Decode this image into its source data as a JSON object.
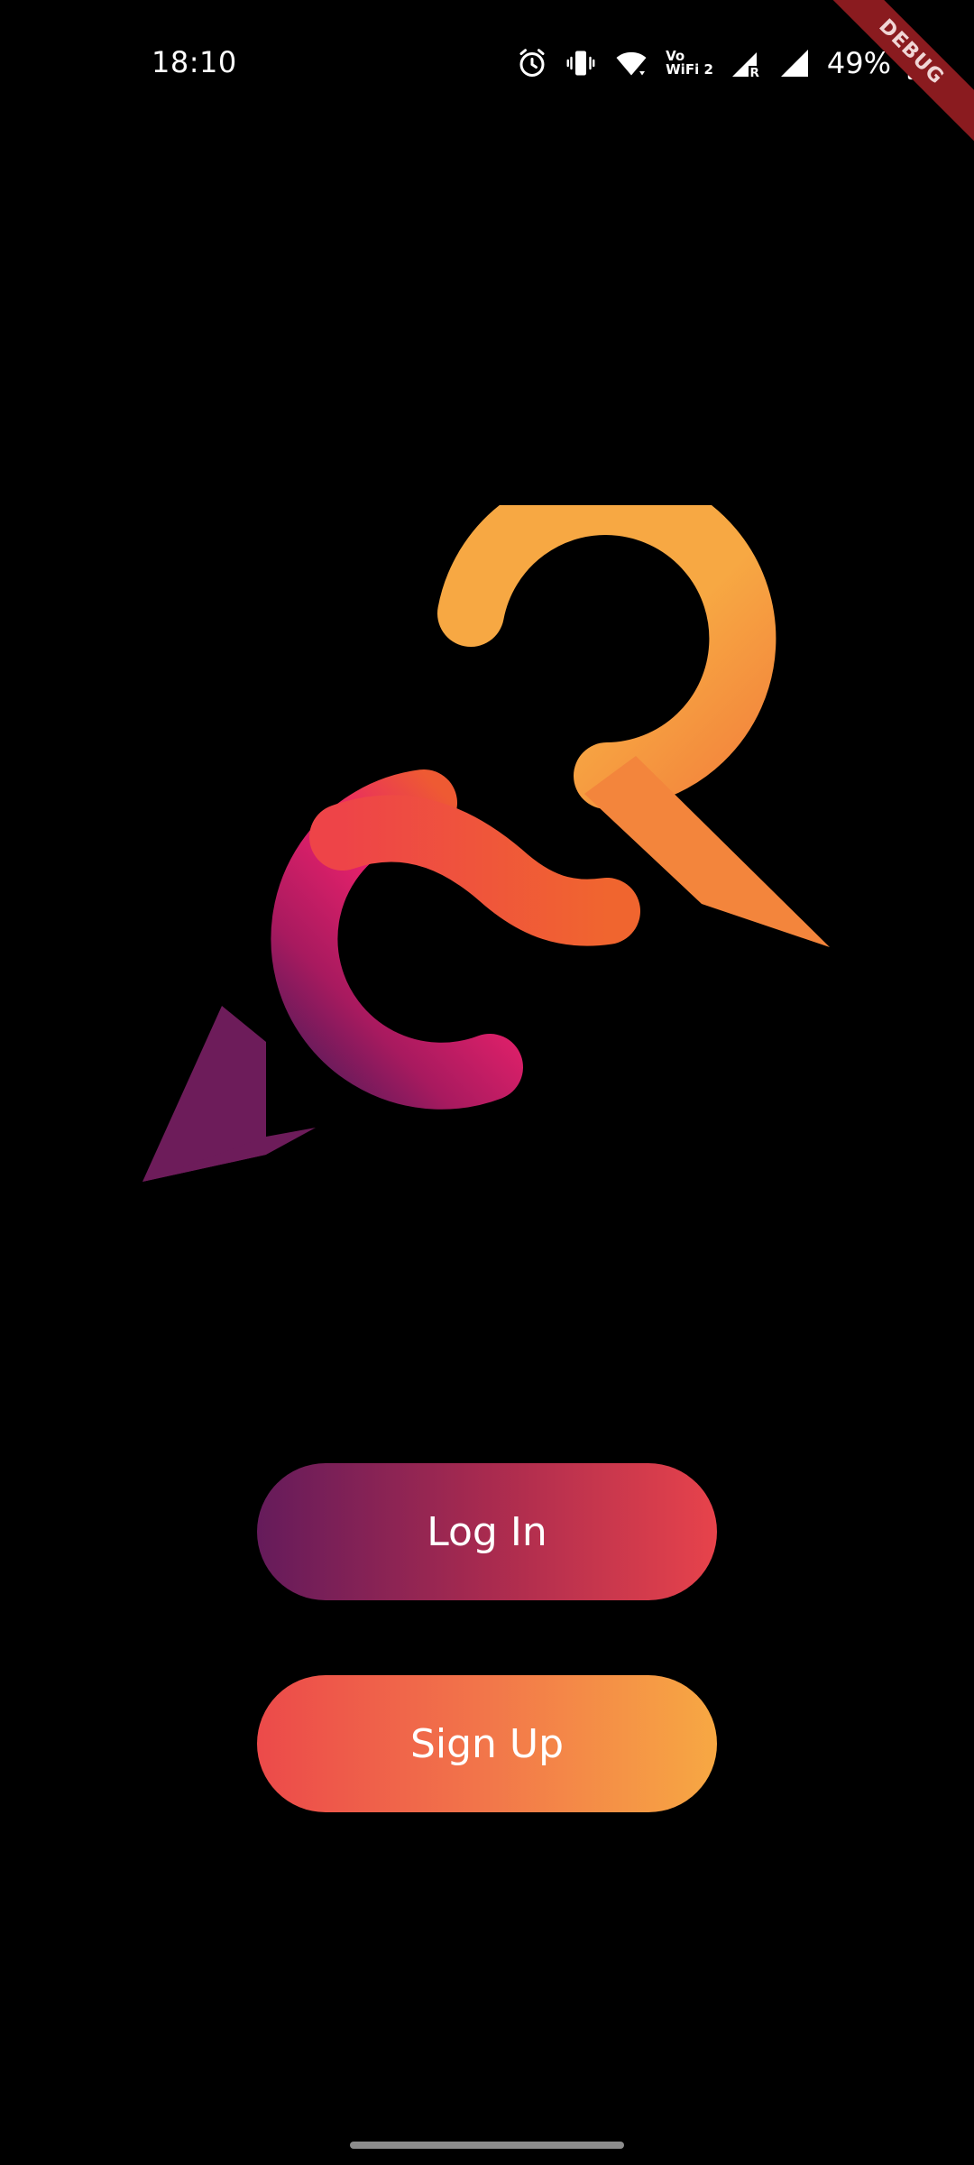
{
  "status_bar": {
    "time": "18:10",
    "wifi_label_top": "Vo",
    "wifi_label_bottom": "WiFi 2",
    "battery_percent": "49%",
    "icons": [
      "alarm-icon",
      "vibrate-icon",
      "wifi-icon",
      "vowifi-icon",
      "signal-r-icon",
      "signal-icon",
      "battery-charging-icon"
    ]
  },
  "debug_banner": {
    "label": "DEBUG",
    "color": "#8a1b1f"
  },
  "logo": {
    "icon": "chat-bubbles-logo-icon",
    "colors": {
      "orange": "#f7a843",
      "red_orange": "#ee5a33",
      "pink": "#e8216b",
      "purple": "#651b5b"
    }
  },
  "buttons": {
    "login_label": "Log In",
    "signup_label": "Sign Up"
  },
  "colors": {
    "background": "#000000",
    "text": "#ffffff"
  }
}
